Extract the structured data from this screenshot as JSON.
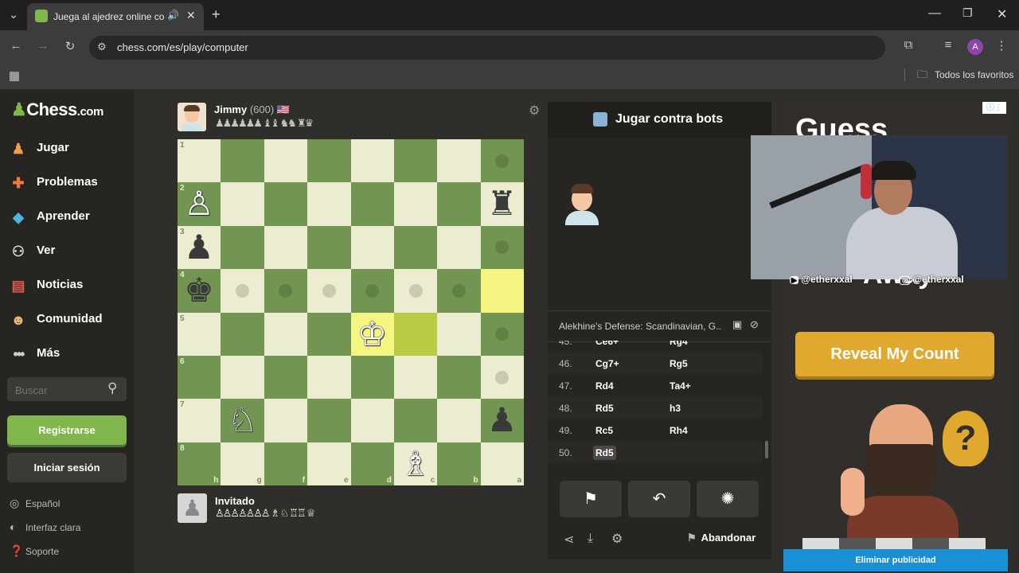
{
  "browser": {
    "tab_title": "Juega al ajedrez online cont",
    "url": "chess.com/es/play/computer",
    "bookmarks_label": "Todos los favoritos",
    "profile_initial": "A"
  },
  "sidebar": {
    "logo_text": "Chess",
    "logo_suffix": ".com",
    "items": [
      {
        "label": "Jugar",
        "icon": "pawn-icon"
      },
      {
        "label": "Problemas",
        "icon": "puzzle-icon"
      },
      {
        "label": "Aprender",
        "icon": "graduation-icon"
      },
      {
        "label": "Ver",
        "icon": "binoculars-icon"
      },
      {
        "label": "Noticias",
        "icon": "newspaper-icon"
      },
      {
        "label": "Comunidad",
        "icon": "community-icon"
      },
      {
        "label": "Más",
        "icon": "more-icon"
      }
    ],
    "search_placeholder": "Buscar",
    "register_label": "Registrarse",
    "login_label": "Iniciar sesión",
    "footer": [
      {
        "label": "Español",
        "icon": "globe-icon"
      },
      {
        "label": "Interfaz clara",
        "icon": "contrast-icon"
      },
      {
        "label": "Soporte",
        "icon": "help-icon"
      }
    ]
  },
  "top_player": {
    "name": "Jimmy",
    "rating": "(600)",
    "flag": "🇺🇸",
    "captured": "♟♟♟♟♟♟ ♝♝ ♞♞ ♜♛"
  },
  "bottom_player": {
    "name": "Invitado",
    "captured": "♙♙♙♙♙♙♙ ♗ ♘ ♖♖ ♕"
  },
  "board": {
    "ranks": [
      "1",
      "2",
      "3",
      "4",
      "5",
      "6",
      "7",
      "8"
    ],
    "files": [
      "h",
      "g",
      "f",
      "e",
      "d",
      "c",
      "b",
      "a"
    ],
    "pieces": [
      {
        "sq": "h2",
        "glyph": "♙",
        "color": "white",
        "name": "white-pawn"
      },
      {
        "sq": "a2",
        "glyph": "♜",
        "color": "black",
        "name": "black-rook"
      },
      {
        "sq": "h3",
        "glyph": "♟",
        "color": "black",
        "name": "black-pawn"
      },
      {
        "sq": "h4",
        "glyph": "♚",
        "color": "black",
        "name": "black-king"
      },
      {
        "sq": "d5",
        "glyph": "♔",
        "color": "white",
        "name": "white-king"
      },
      {
        "sq": "g7",
        "glyph": "♘",
        "color": "white",
        "name": "white-knight"
      },
      {
        "sq": "a7",
        "glyph": "♟",
        "color": "black",
        "name": "black-pawn"
      },
      {
        "sq": "c8",
        "glyph": "♗",
        "color": "white",
        "name": "white-bishop"
      }
    ],
    "highlights": [
      "a4",
      "c5",
      "d5"
    ],
    "move_dots": [
      "a1",
      "a2",
      "a3",
      "g4",
      "f4",
      "e4",
      "d4",
      "c4",
      "b4",
      "a5",
      "a6"
    ]
  },
  "panel": {
    "header": "Jugar contra bots",
    "opening": "Alekhine's Defense: Scandinavian, G...",
    "moves": [
      {
        "n": "45.",
        "w": "Ce6+",
        "b": "Rg4"
      },
      {
        "n": "46.",
        "w": "Cg7+",
        "b": "Rg5"
      },
      {
        "n": "47.",
        "w": "Rd4",
        "b": "Ta4+"
      },
      {
        "n": "48.",
        "w": "Rd5",
        "b": "h3"
      },
      {
        "n": "49.",
        "w": "Rc5",
        "b": "Rh4"
      },
      {
        "n": "50.",
        "w": "Rd5",
        "b": ""
      }
    ],
    "resign_label": "Abandonar"
  },
  "ad": {
    "headline": "Guess",
    "headline2": "Away",
    "button": "Reveal My Count",
    "remove_label": "Eliminar publicidad"
  },
  "overlay": {
    "youtube_handle": "@etherxxal",
    "instagram_handle": "@etherxxal"
  },
  "colors": {
    "brand_green": "#81b64c",
    "board_light": "#ebecd0",
    "board_dark": "#739552",
    "ad_yellow": "#e0a82e"
  }
}
